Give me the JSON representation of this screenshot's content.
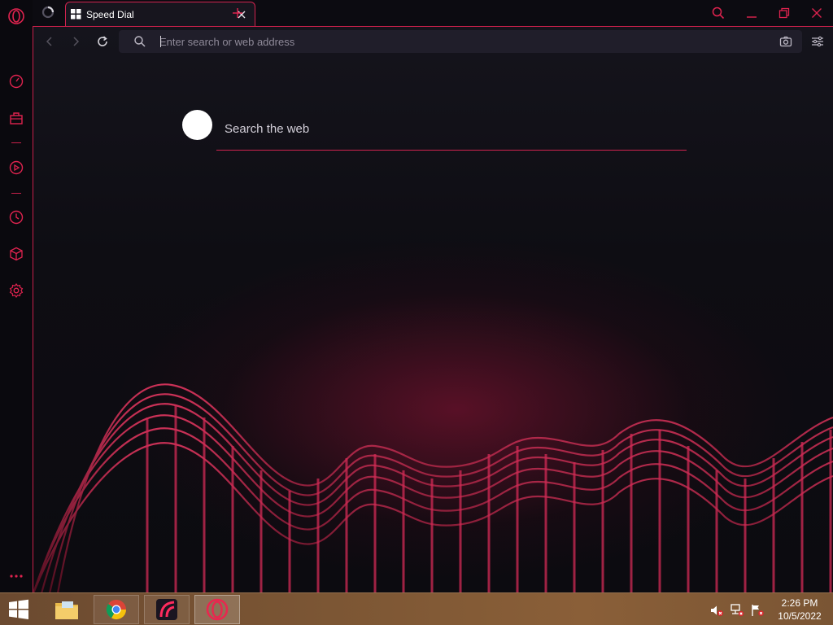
{
  "tabs": [
    {
      "title": "Speed Dial",
      "active": true
    }
  ],
  "addressbar": {
    "placeholder": "Enter search or web address"
  },
  "speed_dial": {
    "search_placeholder": "Search the web"
  },
  "sidebar": {
    "items": [
      {
        "icon": "opera-logo-icon"
      },
      {
        "icon": "speed-dial-icon"
      },
      {
        "icon": "shopping-bag-icon"
      },
      {
        "icon": "player-icon"
      },
      {
        "icon": "history-icon"
      },
      {
        "icon": "extensions-cube-icon"
      },
      {
        "icon": "settings-gear-icon"
      }
    ]
  },
  "taskbar": {
    "apps": [
      "file-explorer-icon",
      "chrome-icon",
      "opera-gx-icon",
      "opera-icon"
    ],
    "clock": {
      "time": "2:26 PM",
      "date": "10/5/2022"
    }
  },
  "colors": {
    "accent": "#d0234f",
    "background": "#0c0b11",
    "addressbar": "#201e2a"
  }
}
